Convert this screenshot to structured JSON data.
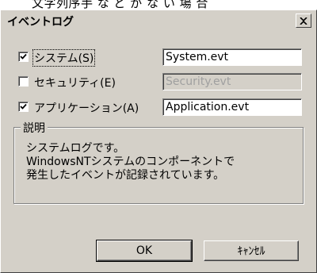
{
  "background_text": "文字列序手 な ど が な い 場 合",
  "window": {
    "title": "イベントログ",
    "close_icon": "close-icon"
  },
  "options": [
    {
      "label": "システム(S)",
      "checked": true,
      "enabled": true,
      "file": "System.evt"
    },
    {
      "label": "セキュリティ(E)",
      "checked": false,
      "enabled": false,
      "file": "Security.evt"
    },
    {
      "label": "アプリケーション(A)",
      "checked": true,
      "enabled": true,
      "file": "Application.evt"
    }
  ],
  "description": {
    "title": "説明",
    "lines": [
      "システムログです。",
      "WindowsNTシステムのコンポーネントで",
      "発生したイベントが記録されています。"
    ]
  },
  "buttons": {
    "ok": "OK",
    "cancel": "ｷｬﾝｾﾙ"
  },
  "colors": {
    "face": "#d4d0c8",
    "shadow": "#808080",
    "highlight": "#ffffff",
    "disabled_text": "#a0a0a0"
  }
}
